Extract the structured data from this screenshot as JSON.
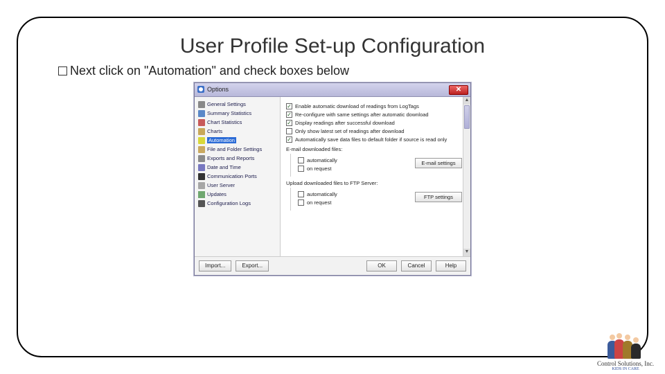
{
  "slide": {
    "title": "User Profile Set-up Configuration",
    "instruction": "Next click on \"Automation\" and check boxes below"
  },
  "window": {
    "title": "Options",
    "sidebar": {
      "items": [
        {
          "label": "General Settings",
          "icon": "gear"
        },
        {
          "label": "Summary Statistics",
          "icon": "sum"
        },
        {
          "label": "Chart Statistics",
          "icon": "chart"
        },
        {
          "label": "Charts",
          "icon": "charts"
        },
        {
          "label": "Automation",
          "icon": "auto",
          "selected": true
        },
        {
          "label": "File and Folder Settings",
          "icon": "file"
        },
        {
          "label": "Exports and Reports",
          "icon": "export"
        },
        {
          "label": "Date and Time",
          "icon": "date"
        },
        {
          "label": "Communication Ports",
          "icon": "comm"
        },
        {
          "label": "User Server",
          "icon": "user"
        },
        {
          "label": "Updates",
          "icon": "upd"
        },
        {
          "label": "Configuration Logs",
          "icon": "log"
        }
      ]
    },
    "content": {
      "checks": [
        {
          "label": "Enable automatic download of readings from LogTags",
          "checked": true
        },
        {
          "label": "Re-configure with same settings after automatic download",
          "checked": true
        },
        {
          "label": "Display readings after successful download",
          "checked": true
        },
        {
          "label": "Only show latest set of readings after download",
          "checked": false
        },
        {
          "label": "Automatically save data files to default folder if source is read only",
          "checked": true
        }
      ],
      "email_group": {
        "heading": "E-mail downloaded files:",
        "opts": [
          {
            "label": "automatically",
            "checked": false
          },
          {
            "label": "on request",
            "checked": false
          }
        ],
        "button": "E-mail settings"
      },
      "ftp_group": {
        "heading": "Upload downloaded files to FTP Server:",
        "opts": [
          {
            "label": "automatically",
            "checked": false
          },
          {
            "label": "on request",
            "checked": false
          }
        ],
        "button": "FTP settings"
      }
    },
    "footer": {
      "import": "Import...",
      "export": "Export...",
      "ok": "OK",
      "cancel": "Cancel",
      "help": "Help"
    }
  },
  "logo": {
    "name": "Control Solutions, Inc.",
    "tagline": "KIDS IN CARE"
  }
}
